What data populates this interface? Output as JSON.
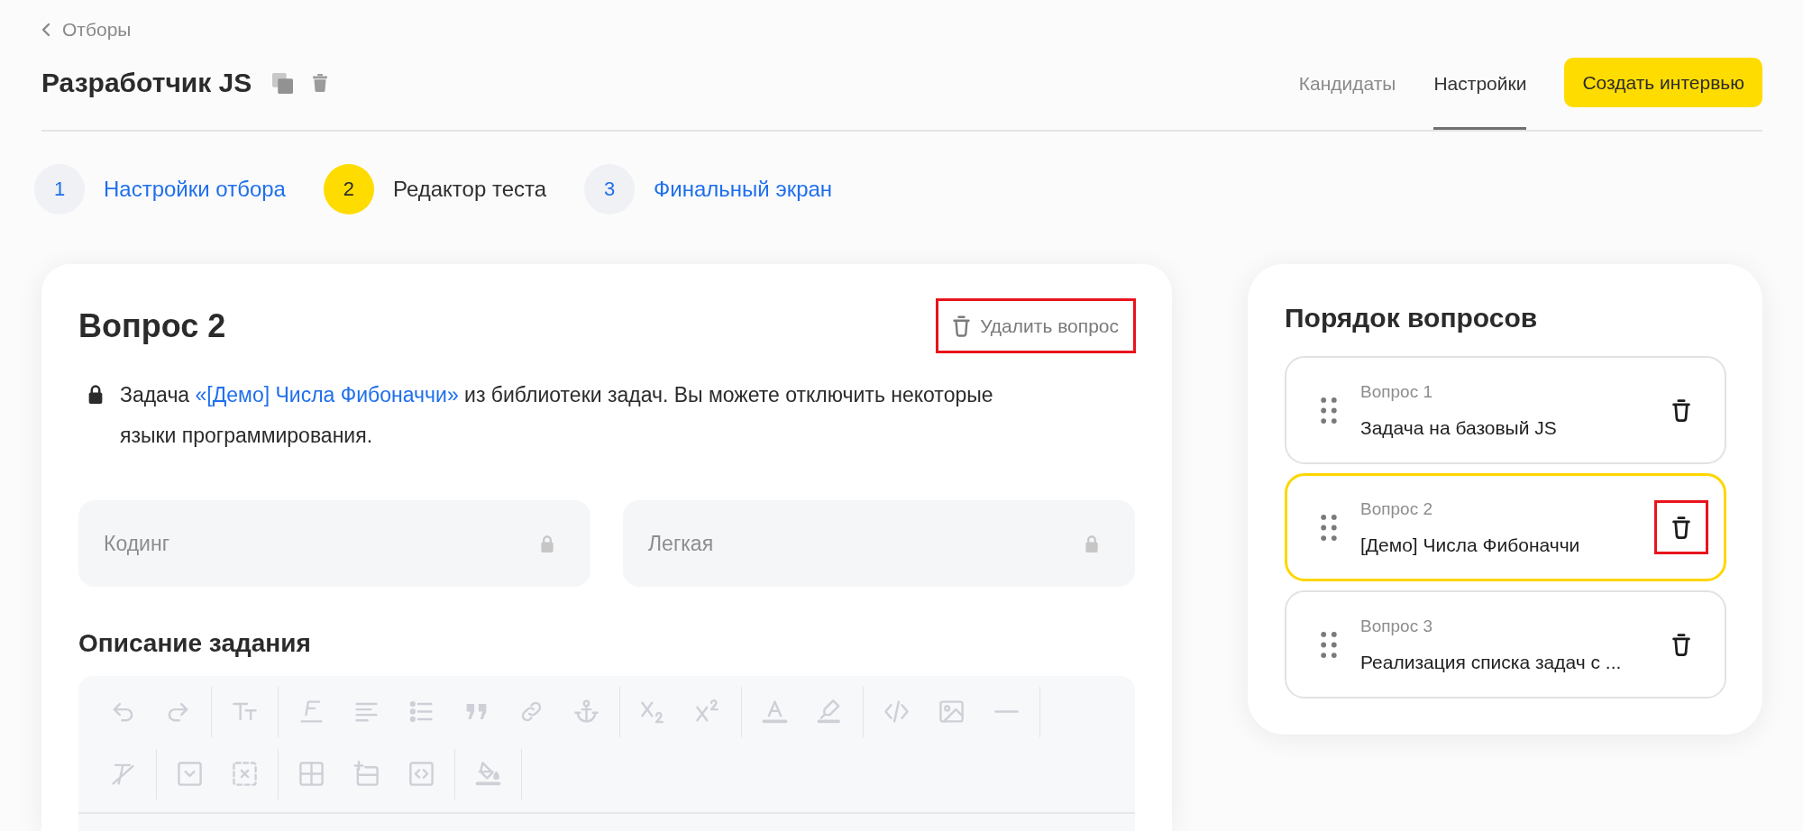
{
  "back_link": {
    "label": "Отборы"
  },
  "header": {
    "title": "Разработчик JS",
    "tabs": [
      {
        "label": "Кандидаты",
        "selected": false
      },
      {
        "label": "Настройки",
        "selected": true
      }
    ],
    "create_button": {
      "label": "Создать интервью"
    }
  },
  "steps": [
    {
      "number": "1",
      "label": "Настройки отбора",
      "selected": false
    },
    {
      "number": "2",
      "label": "Редактор теста",
      "selected": true
    },
    {
      "number": "3",
      "label": "Финальный экран",
      "selected": false
    }
  ],
  "question": {
    "title": "Вопрос 2",
    "delete_button": {
      "label": "Удалить вопрос",
      "highlighted": true
    },
    "notice": {
      "locked": true,
      "before": "Задача ",
      "link": "«[Демо] Числа Фибоначчи»",
      "after": " из библиотеки задач. Вы можете отключить некоторые языки программирования."
    },
    "fields": [
      {
        "value": "Кодинг",
        "disabled": true
      },
      {
        "value": "Легкая",
        "disabled": true
      }
    ],
    "description": {
      "heading": "Описание задания",
      "toolbar_disabled": true
    }
  },
  "question_order": {
    "title": "Порядок вопросов",
    "items": [
      {
        "label": "Вопрос 1",
        "title": "Задача на базовый JS",
        "selected": false,
        "delete_highlighted": false
      },
      {
        "label": "Вопрос 2",
        "title": "[Демо] Числа Фибоначчи",
        "selected": true,
        "delete_highlighted": true
      },
      {
        "label": "Вопрос 3",
        "title": "Реализация списка задач с ...",
        "selected": false,
        "delete_highlighted": false
      }
    ]
  }
}
